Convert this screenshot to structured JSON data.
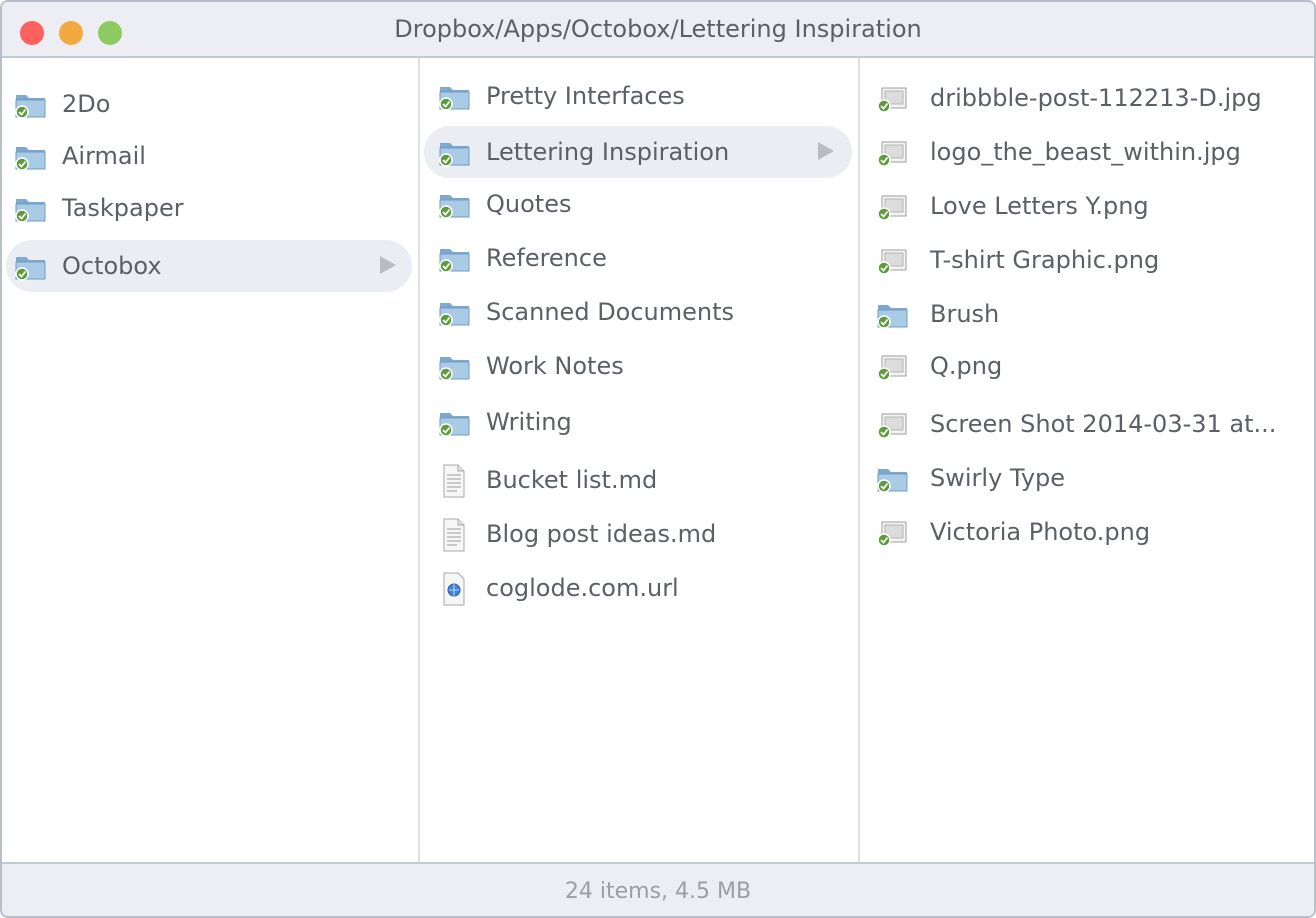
{
  "window": {
    "title": "Dropbox/Apps/Octobox/Lettering Inspiration"
  },
  "colors": {
    "close": "#fc615d",
    "minimize": "#f2a942",
    "maximize": "#8dcb62",
    "selection": "#eaedf1",
    "text": "#5b5f66"
  },
  "columns": [
    {
      "items": [
        {
          "label": "2Do",
          "icon": "folder-icon",
          "selected": false
        },
        {
          "label": "Airmail",
          "icon": "folder-icon",
          "selected": false
        },
        {
          "label": "Taskpaper",
          "icon": "folder-icon",
          "selected": false
        },
        {
          "label": "Octobox",
          "icon": "folder-icon",
          "selected": true
        }
      ]
    },
    {
      "items": [
        {
          "label": "Pretty Interfaces",
          "icon": "folder-icon",
          "selected": false
        },
        {
          "label": "Lettering Inspiration",
          "icon": "folder-icon",
          "selected": true
        },
        {
          "label": "Quotes",
          "icon": "folder-icon",
          "selected": false
        },
        {
          "label": "Reference",
          "icon": "folder-icon",
          "selected": false
        },
        {
          "label": "Scanned Documents",
          "icon": "folder-icon",
          "selected": false
        },
        {
          "label": "Work Notes",
          "icon": "folder-icon",
          "selected": false
        },
        {
          "label": "Writing",
          "icon": "folder-icon",
          "selected": false
        },
        {
          "label": "Bucket list.md",
          "icon": "text-file-icon",
          "selected": false
        },
        {
          "label": "Blog post ideas.md",
          "icon": "text-file-icon",
          "selected": false
        },
        {
          "label": "coglode.com.url",
          "icon": "url-file-icon",
          "selected": false
        }
      ]
    },
    {
      "items": [
        {
          "label": "dribbble-post-112213-D.jpg",
          "icon": "image-file-icon",
          "selected": false
        },
        {
          "label": "logo_the_beast_within.jpg",
          "icon": "image-file-icon",
          "selected": false
        },
        {
          "label": "Love Letters Y.png",
          "icon": "image-file-icon",
          "selected": false
        },
        {
          "label": "T-shirt Graphic.png",
          "icon": "image-file-icon",
          "selected": false
        },
        {
          "label": "Brush",
          "icon": "folder-icon",
          "selected": false
        },
        {
          "label": "Q.png",
          "icon": "image-file-icon",
          "selected": false
        },
        {
          "label": "Screen Shot 2014-03-31 at...",
          "icon": "image-file-icon",
          "selected": false
        },
        {
          "label": "Swirly Type",
          "icon": "folder-icon",
          "selected": false
        },
        {
          "label": "Victoria Photo.png",
          "icon": "image-file-icon",
          "selected": false
        }
      ]
    }
  ],
  "status": {
    "text": "24 items, 4.5 MB"
  }
}
